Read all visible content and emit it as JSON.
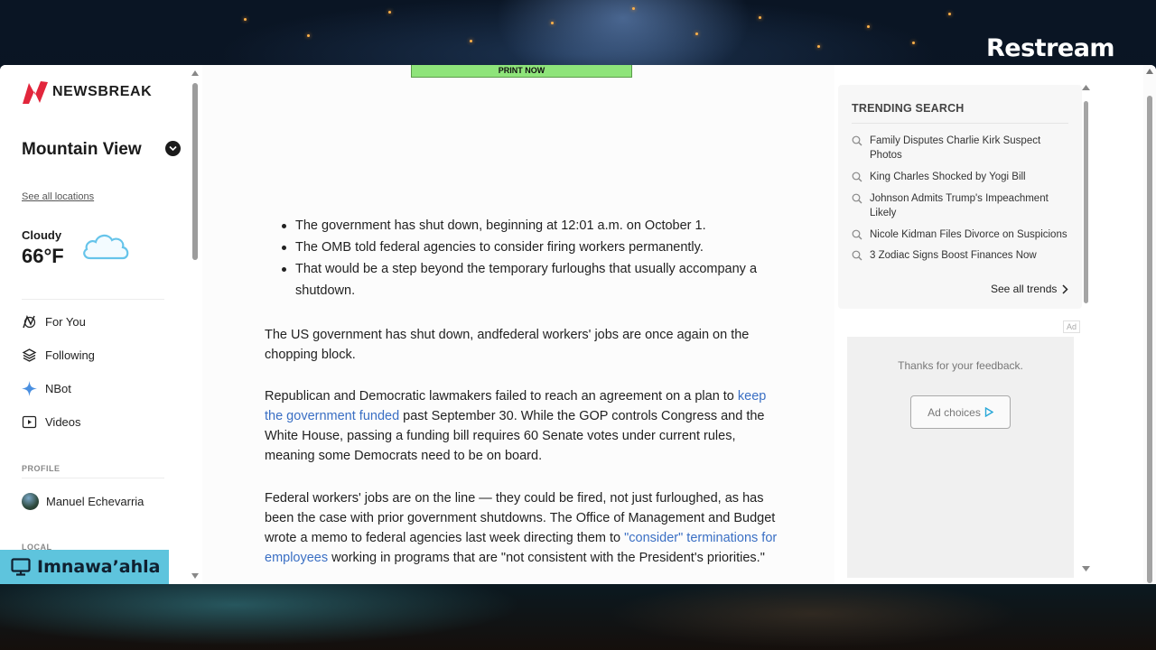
{
  "stream": {
    "brand": "Restream",
    "presenter_name": "Imnawa’ahla"
  },
  "sidebar": {
    "logo_text": "NEWSBREAK",
    "location": "Mountain View",
    "see_all_locations": "See all locations",
    "weather": {
      "condition": "Cloudy",
      "temperature": "66°F"
    },
    "nav": [
      {
        "label": "For You",
        "icon": "for-you-icon"
      },
      {
        "label": "Following",
        "icon": "layers-icon"
      },
      {
        "label": "NBot",
        "icon": "sparkle-icon"
      },
      {
        "label": "Videos",
        "icon": "video-icon"
      }
    ],
    "profile_label": "PROFILE",
    "profile_name": "Manuel Echevarria",
    "local_label": "LOCAL"
  },
  "article": {
    "print_banner": "PRINT NOW",
    "bullets": [
      "The government has shut down, beginning at 12:01 a.m. on October 1.",
      "The OMB told federal agencies to consider firing workers permanently.",
      "That would be a step beyond the temporary furloughs that usually accompany a shutdown."
    ],
    "p1": "The US government has shut down, andfederal workers' jobs are once again on the chopping block.",
    "p2": {
      "before": "Republican and Democratic lawmakers failed to reach an agreement on a plan to ",
      "link": "keep the government funded",
      "after": " past September 30. While the GOP controls Congress and the White House, passing a funding bill requires 60 Senate votes under current rules, meaning some Democrats need to be on board."
    },
    "p3": {
      "before": "Federal workers' jobs are on the line — they could be fired, not just furloughed, as has been the case with prior government shutdowns. The Office of Management and Budget wrote a memo to federal agencies last week directing them to ",
      "link": "\"consider\" terminations for employees",
      "after": " working in programs that are \"not consistent with the President's priorities.\""
    }
  },
  "trending": {
    "title": "TRENDING SEARCH",
    "items": [
      "Family Disputes Charlie Kirk Suspect Photos",
      "King Charles Shocked by Yogi Bill",
      "Johnson Admits Trump's Impeachment Likely",
      "Nicole Kidman Files Divorce on Suspicions",
      "3 Zodiac Signs Boost Finances Now"
    ],
    "see_all": "See all trends"
  },
  "ad": {
    "tag": "Ad",
    "thanks": "Thanks for your feedback.",
    "choices": "Ad choices"
  },
  "colors": {
    "brand_red": "#e2263c",
    "link_blue": "#3a6fc4",
    "print_green": "#8ee47a",
    "name_tag_cyan": "#5ec4dd"
  }
}
